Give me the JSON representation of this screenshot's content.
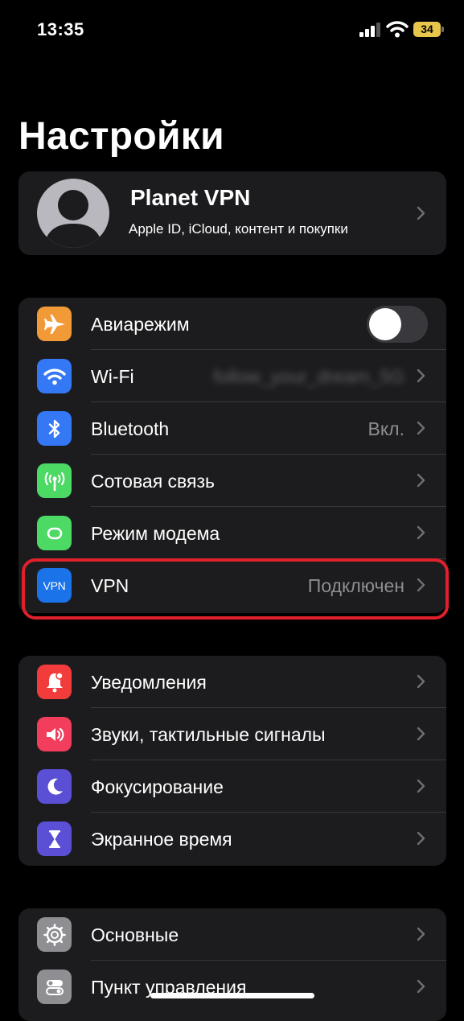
{
  "status_bar": {
    "time": "13:35",
    "battery": "34"
  },
  "page": {
    "title": "Настройки"
  },
  "profile": {
    "name": "Planet VPN",
    "subtitle": "Apple ID, iCloud, контент и покупки"
  },
  "sections": {
    "connectivity": [
      {
        "label": "Авиарежим",
        "icon": "airplane-icon",
        "color": "#f19a37",
        "toggle": "off"
      },
      {
        "label": "Wi-Fi",
        "icon": "wifi-icon",
        "color": "#3478f6",
        "value": "follow_your_dream_5G"
      },
      {
        "label": "Bluetooth",
        "icon": "bluetooth-icon",
        "color": "#3478f6",
        "value": "Вкл."
      },
      {
        "label": "Сотовая связь",
        "icon": "antenna-icon",
        "color": "#4cd964"
      },
      {
        "label": "Режим модема",
        "icon": "link-icon",
        "color": "#4cd964"
      },
      {
        "label": "VPN",
        "icon": "vpn-icon",
        "icon_text": "VPN",
        "color": "#1a73e8",
        "value": "Подключен"
      }
    ],
    "notifications": [
      {
        "label": "Уведомления",
        "icon": "bell-icon",
        "color": "#f23c3c"
      },
      {
        "label": "Звуки, тактильные сигналы",
        "icon": "speaker-icon",
        "color": "#f23d5c"
      },
      {
        "label": "Фокусирование",
        "icon": "moon-icon",
        "color": "#5b4fd6"
      },
      {
        "label": "Экранное время",
        "icon": "hourglass-icon",
        "color": "#5b4fd6"
      }
    ],
    "general": [
      {
        "label": "Основные",
        "icon": "gear-icon",
        "color": "#8e8e93"
      },
      {
        "label": "Пункт управления",
        "icon": "switches-icon",
        "color": "#8e8e93"
      }
    ]
  },
  "colors": {
    "background": "#000000",
    "card": "#1c1c1e",
    "separator": "#38383a",
    "highlight": "#e0202b",
    "battery": "#e8c54b"
  }
}
